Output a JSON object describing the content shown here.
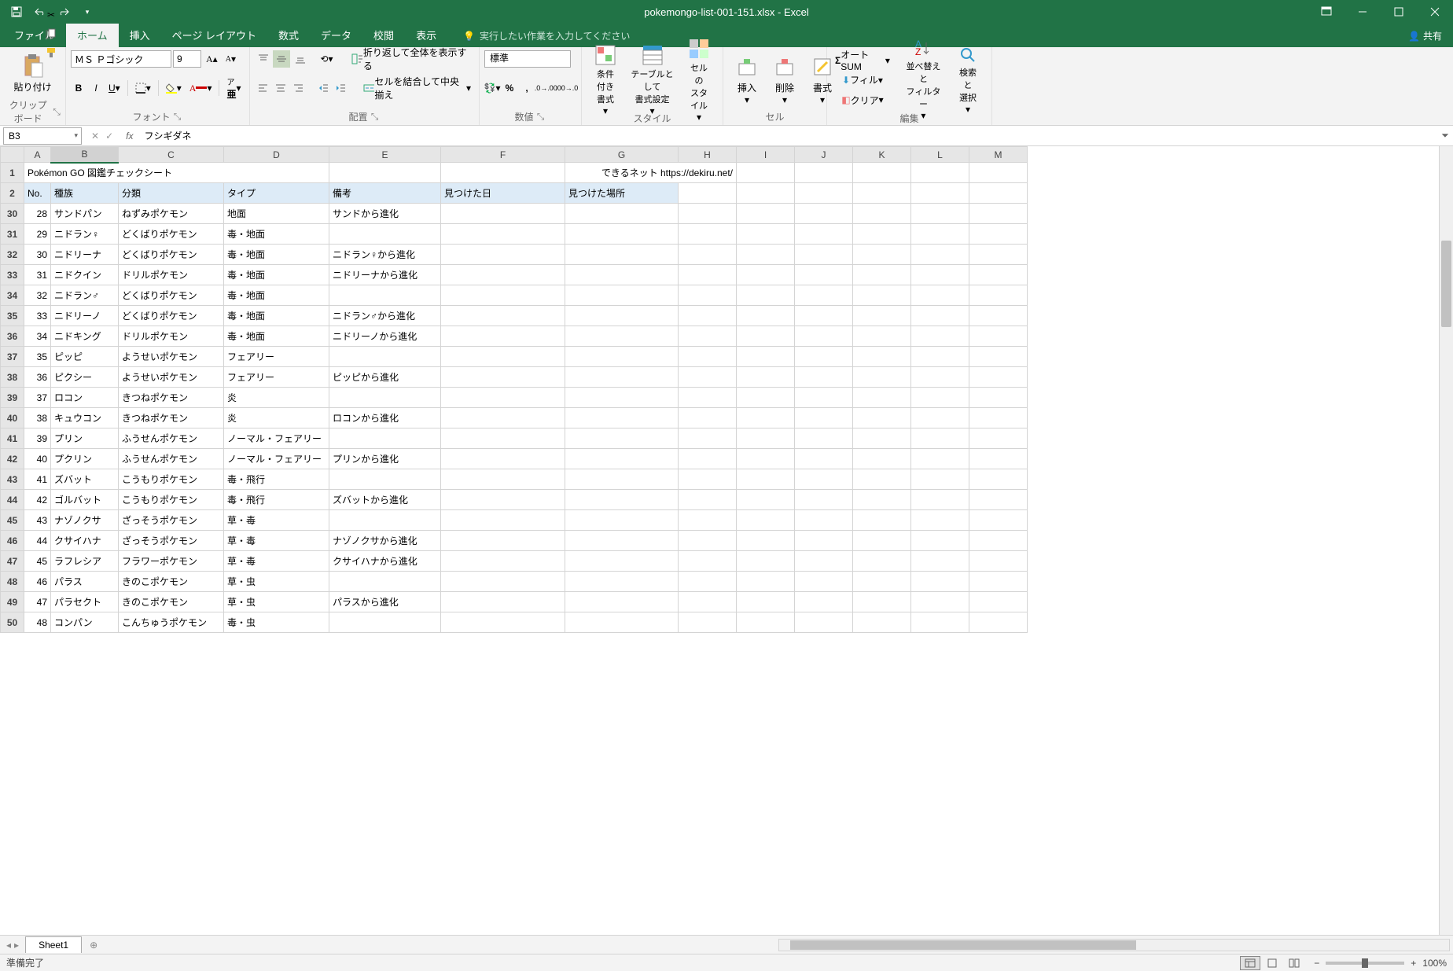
{
  "title": "pokemongo-list-001-151.xlsx - Excel",
  "tabs": {
    "file": "ファイル",
    "home": "ホーム",
    "insert": "挿入",
    "pagelayout": "ページ レイアウト",
    "formulas": "数式",
    "data": "データ",
    "review": "校閲",
    "view": "表示",
    "tellme": "実行したい作業を入力してください",
    "share": "共有"
  },
  "ribbon": {
    "clipboard": {
      "paste": "貼り付け",
      "label": "クリップボード"
    },
    "font": {
      "name": "ＭＳ Ｐゴシック",
      "size": "9",
      "label": "フォント"
    },
    "align": {
      "wrap": "折り返して全体を表示する",
      "merge": "セルを結合して中央揃え",
      "label": "配置"
    },
    "number": {
      "format": "標準",
      "label": "数値"
    },
    "styles": {
      "cond": "条件付き\n書式",
      "table": "テーブルとして\n書式設定",
      "cell": "セルの\nスタイル",
      "label": "スタイル"
    },
    "cells": {
      "insert": "挿入",
      "delete": "削除",
      "format": "書式",
      "label": "セル"
    },
    "editing": {
      "autosum": "オート SUM",
      "fill": "フィル",
      "clear": "クリア",
      "sort": "並べ替えと\nフィルター",
      "find": "検索と\n選択",
      "label": "編集"
    }
  },
  "nameBox": "B3",
  "formula": "フシギダネ",
  "columns": [
    "A",
    "B",
    "C",
    "D",
    "E",
    "F",
    "G",
    "H",
    "I",
    "J",
    "K",
    "L",
    "M"
  ],
  "titleRow": {
    "a": "Pokémon GO  図鑑チェックシート",
    "g": "できるネット  https://dekiru.net/"
  },
  "headerRow": {
    "a": "No.",
    "b": "種族",
    "c": "分類",
    "d": "タイプ",
    "e": "備考",
    "f": "見つけた日",
    "g": "見つけた場所"
  },
  "rows": [
    {
      "rh": "30",
      "no": "28",
      "b": "サンドパン",
      "c": "ねずみポケモン",
      "d": "地面",
      "e": "サンドから進化"
    },
    {
      "rh": "31",
      "no": "29",
      "b": "ニドラン♀",
      "c": "どくばりポケモン",
      "d": "毒・地面",
      "e": ""
    },
    {
      "rh": "32",
      "no": "30",
      "b": "ニドリーナ",
      "c": "どくばりポケモン",
      "d": "毒・地面",
      "e": "ニドラン♀から進化"
    },
    {
      "rh": "33",
      "no": "31",
      "b": "ニドクイン",
      "c": "ドリルポケモン",
      "d": "毒・地面",
      "e": "ニドリーナから進化"
    },
    {
      "rh": "34",
      "no": "32",
      "b": "ニドラン♂",
      "c": "どくばりポケモン",
      "d": "毒・地面",
      "e": ""
    },
    {
      "rh": "35",
      "no": "33",
      "b": "ニドリーノ",
      "c": "どくばりポケモン",
      "d": "毒・地面",
      "e": "ニドラン♂から進化"
    },
    {
      "rh": "36",
      "no": "34",
      "b": "ニドキング",
      "c": "ドリルポケモン",
      "d": "毒・地面",
      "e": "ニドリーノから進化"
    },
    {
      "rh": "37",
      "no": "35",
      "b": "ピッピ",
      "c": "ようせいポケモン",
      "d": "フェアリー",
      "e": ""
    },
    {
      "rh": "38",
      "no": "36",
      "b": "ピクシー",
      "c": "ようせいポケモン",
      "d": "フェアリー",
      "e": "ピッピから進化"
    },
    {
      "rh": "39",
      "no": "37",
      "b": "ロコン",
      "c": "きつねポケモン",
      "d": "炎",
      "e": ""
    },
    {
      "rh": "40",
      "no": "38",
      "b": "キュウコン",
      "c": "きつねポケモン",
      "d": "炎",
      "e": "ロコンから進化"
    },
    {
      "rh": "41",
      "no": "39",
      "b": "プリン",
      "c": "ふうせんポケモン",
      "d": "ノーマル・フェアリー",
      "e": ""
    },
    {
      "rh": "42",
      "no": "40",
      "b": "プクリン",
      "c": "ふうせんポケモン",
      "d": "ノーマル・フェアリー",
      "e": "プリンから進化"
    },
    {
      "rh": "43",
      "no": "41",
      "b": "ズバット",
      "c": "こうもりポケモン",
      "d": "毒・飛行",
      "e": ""
    },
    {
      "rh": "44",
      "no": "42",
      "b": "ゴルバット",
      "c": "こうもりポケモン",
      "d": "毒・飛行",
      "e": "ズバットから進化"
    },
    {
      "rh": "45",
      "no": "43",
      "b": "ナゾノクサ",
      "c": "ざっそうポケモン",
      "d": "草・毒",
      "e": ""
    },
    {
      "rh": "46",
      "no": "44",
      "b": "クサイハナ",
      "c": "ざっそうポケモン",
      "d": "草・毒",
      "e": "ナゾノクサから進化"
    },
    {
      "rh": "47",
      "no": "45",
      "b": "ラフレシア",
      "c": "フラワーポケモン",
      "d": "草・毒",
      "e": "クサイハナから進化"
    },
    {
      "rh": "48",
      "no": "46",
      "b": "パラス",
      "c": "きのこポケモン",
      "d": "草・虫",
      "e": ""
    },
    {
      "rh": "49",
      "no": "47",
      "b": "パラセクト",
      "c": "きのこポケモン",
      "d": "草・虫",
      "e": "パラスから進化"
    },
    {
      "rh": "50",
      "no": "48",
      "b": "コンパン",
      "c": "こんちゅうポケモン",
      "d": "毒・虫",
      "e": ""
    }
  ],
  "sheetTab": "Sheet1",
  "status": "準備完了",
  "zoom": "100%"
}
